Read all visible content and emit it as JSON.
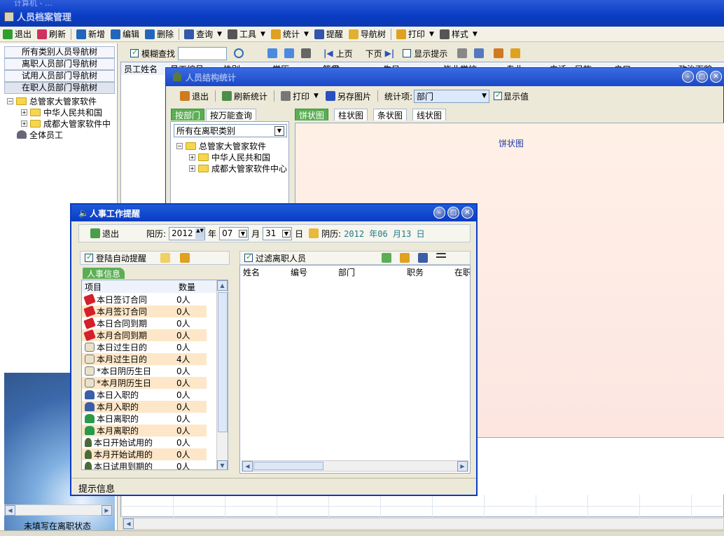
{
  "main_window": {
    "title": "人员档案管理",
    "subtitle": "计算机 - ..."
  },
  "toolbar": [
    {
      "label": "退出",
      "icon": "exit-icon",
      "color": "#2f9e2f"
    },
    {
      "label": "刷新",
      "icon": "refresh-icon",
      "color": "#d03060"
    },
    {
      "label": "新增",
      "icon": "add-icon",
      "color": "#2266bb"
    },
    {
      "label": "编辑",
      "icon": "edit-icon",
      "color": "#2266bb"
    },
    {
      "label": "删除",
      "icon": "delete-icon",
      "color": "#2266bb"
    },
    {
      "label": "查询",
      "icon": "binoculars-icon",
      "color": "#3355aa",
      "dropdown": true
    },
    {
      "label": "工具",
      "icon": "tools-icon",
      "color": "#555555",
      "dropdown": true
    },
    {
      "label": "统计",
      "icon": "chart-icon",
      "color": "#e0a020",
      "dropdown": true
    },
    {
      "label": "提醒",
      "icon": "speaker-icon",
      "color": "#3355aa"
    },
    {
      "label": "导航树",
      "icon": "folder-icon",
      "color": "#e0b030"
    },
    {
      "label": "打印",
      "icon": "printer-icon",
      "color": "#e0a020",
      "dropdown": true
    },
    {
      "label": "样式",
      "icon": "style-icon",
      "color": "#555555",
      "dropdown": true
    }
  ],
  "nav_buttons": [
    "所有类别人员导航树",
    "离职人员部门导航树",
    "试用人员部门导航树",
    "在职人员部门导航树"
  ],
  "left_tree": {
    "root": "总管家大管家软件",
    "children": [
      "中华人民共和国",
      "成都大管家软件中"
    ],
    "all": "全体员工"
  },
  "left_status": "未填写在离职状态",
  "second_toolbar": {
    "fuzzy_label": "模糊查找",
    "prev_label": "上页",
    "next_label": "下页",
    "show_hint_label": "显示提示"
  },
  "grid_headers": [
    "员工姓名",
    "员工编号",
    "性别",
    "学历",
    "籍贯",
    "生日",
    "毕业学校",
    "专业",
    "电话",
    "民族",
    "户口",
    "政治面貌"
  ],
  "stats_window": {
    "title": "人员结构统计",
    "toolbar": {
      "exit": "退出",
      "refresh": "刷新统计",
      "print": "打印",
      "save_image": "另存图片",
      "stat_item_label": "统计项:",
      "stat_item_value": "部门",
      "show_value_label": "显示值"
    },
    "left_tabs": [
      "按部门",
      "按万能查询"
    ],
    "category_select": "所有在离职类别",
    "tree": {
      "root": "总管家大管家软件",
      "children": [
        "中华人民共和国",
        "成都大管家软件中心"
      ]
    },
    "chart_tabs": [
      "饼状图",
      "柱状图",
      "条状图",
      "线状图"
    ],
    "chart_label": "饼状图"
  },
  "reminder_window": {
    "title": "人事工作提醒",
    "exit_label": "退出",
    "calendar_label": "阳历:",
    "year": "2012",
    "year_unit": "年",
    "month": "07",
    "month_unit": "月",
    "day": "31",
    "day_unit": "日",
    "lunar_label": "阴历:",
    "lunar_value": "2012 年06 月13 日",
    "auto_remind_label": "登陆自动提醒",
    "info_tab": "人事信息",
    "list_headers": [
      "项目",
      "数量"
    ],
    "items": [
      {
        "name": "本日签订合同",
        "count": "0人",
        "icon": "contract-icon"
      },
      {
        "name": "本月签订合同",
        "count": "0人",
        "icon": "contract-icon"
      },
      {
        "name": "本日合同到期",
        "count": "0人",
        "icon": "contract-icon"
      },
      {
        "name": "本月合同到期",
        "count": "0人",
        "icon": "contract-icon"
      },
      {
        "name": "本日过生日的",
        "count": "0人",
        "icon": "cake-icon"
      },
      {
        "name": "本月过生日的",
        "count": "4人",
        "icon": "cake-icon"
      },
      {
        "name": "*本日阴历生日",
        "count": "0人",
        "icon": "cake-icon"
      },
      {
        "name": "*本月阴历生日",
        "count": "0人",
        "icon": "cake-icon"
      },
      {
        "name": "本日入职的",
        "count": "0人",
        "icon": "person-add-icon"
      },
      {
        "name": "本月入职的",
        "count": "0人",
        "icon": "person-add-icon"
      },
      {
        "name": "本日离职的",
        "count": "0人",
        "icon": "people-icon"
      },
      {
        "name": "本月离职的",
        "count": "0人",
        "icon": "people-icon"
      },
      {
        "name": "本日开始试用的",
        "count": "0人",
        "icon": "person-icon"
      },
      {
        "name": "本月开始试用的",
        "count": "0人",
        "icon": "person-icon"
      },
      {
        "name": "本日试用到期的",
        "count": "0人",
        "icon": "person-icon"
      }
    ],
    "filter_label": "过滤离职人员",
    "right_headers": [
      "姓名",
      "编号",
      "部门",
      "职务",
      "在职"
    ],
    "status": "提示信息"
  }
}
